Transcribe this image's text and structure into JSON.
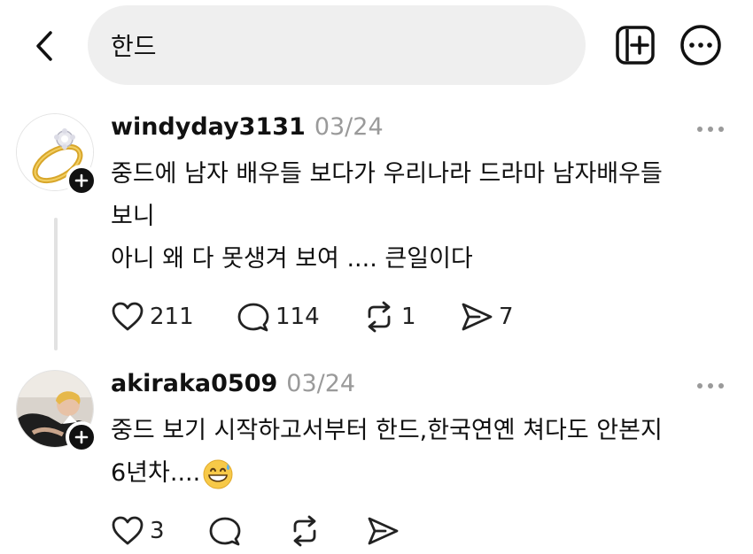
{
  "search": {
    "query": "한드"
  },
  "posts": [
    {
      "username": "windyday3131",
      "time": "03/24",
      "lines": [
        "중드에 남자 배우들 보다가 우리나라 드라마 남자배우들",
        "보니",
        "아니 왜 다 못생겨 보여 .... 큰일이다"
      ],
      "likes": "211",
      "replies": "114",
      "reposts": "1",
      "shares": "7"
    },
    {
      "username": "akiraka0509",
      "time": "03/24",
      "lines": [
        "중드 보기 시작하고서부터 한드,한국연옌 쳐다도 안본지",
        "6년차...."
      ],
      "emoji": "grinning-face-with-sweat",
      "likes": "3"
    }
  ]
}
